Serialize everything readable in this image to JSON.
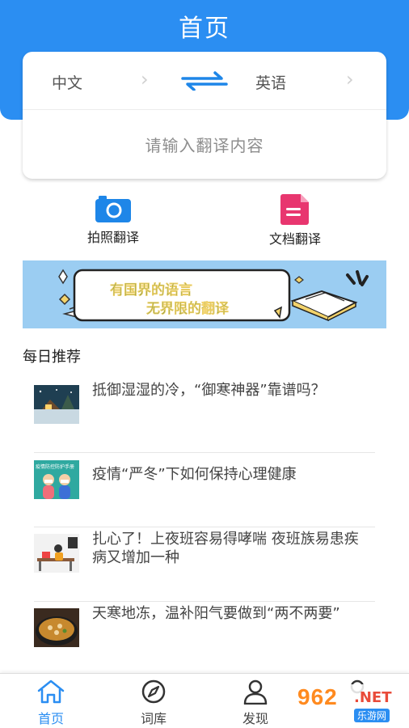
{
  "header": {
    "title": "首页"
  },
  "translator": {
    "source_lang": "中文",
    "target_lang": "英语",
    "placeholder": "请输入翻译内容"
  },
  "tools": [
    {
      "label": "拍照翻译",
      "icon": "camera-icon"
    },
    {
      "label": "文档翻译",
      "icon": "document-icon"
    }
  ],
  "banner": {
    "line1": "有国界的语言",
    "line2": "无界限的翻译"
  },
  "daily": {
    "title": "每日推荐",
    "items": [
      {
        "text": "抵御湿湿的冷，“御寒神器”靠谱吗？"
      },
      {
        "text": "疫情“严冬”下如何保持心理健康",
        "thumb_caption": "疫情防控防护手册"
      },
      {
        "text": "扎心了！上夜班容易得哮喘 夜班族易患疾病又增加一种"
      },
      {
        "text": "天寒地冻，温补阳气要做到“两不两要”"
      }
    ]
  },
  "tabbar": {
    "items": [
      {
        "label": "首页",
        "icon": "home-icon",
        "active": true
      },
      {
        "label": "词库",
        "icon": "compass-icon",
        "active": false
      },
      {
        "label": "发现",
        "icon": "person-icon",
        "active": false
      },
      {
        "label": "",
        "icon": "profile-icon",
        "active": false
      }
    ]
  },
  "watermark": {
    "brand": "962",
    "suffix": ".NET",
    "sub": "乐游网"
  },
  "colors": {
    "primary": "#2b8ef2",
    "doc_icon": "#e8366f",
    "banner_bg": "#9bcdf2"
  }
}
